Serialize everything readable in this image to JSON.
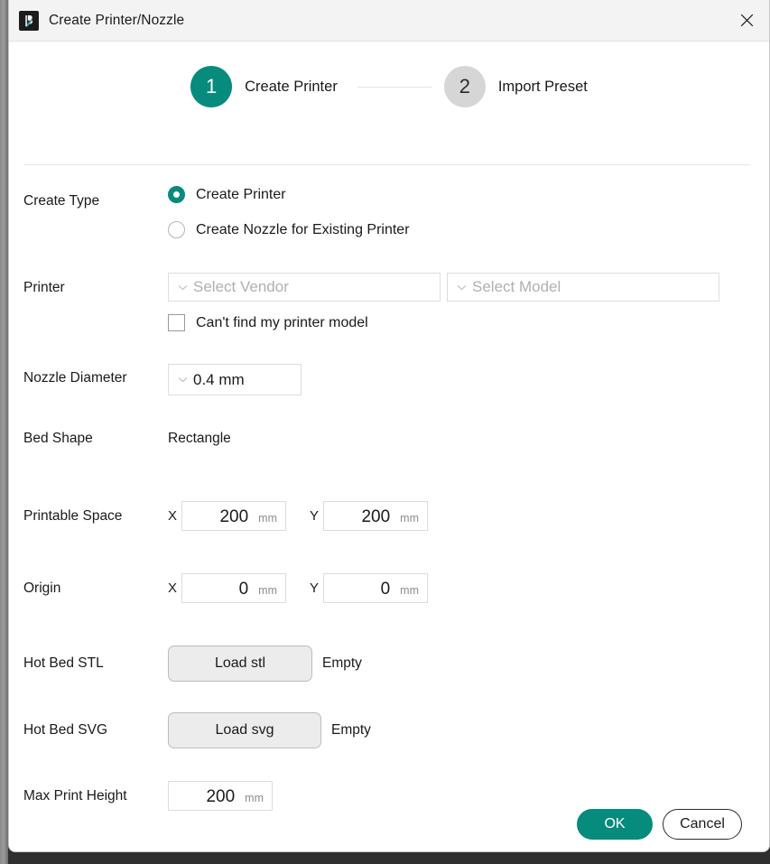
{
  "window": {
    "title": "Create Printer/Nozzle",
    "app_icon": "bambu-logo-icon",
    "close_label": "✕"
  },
  "theme": {
    "accent": "#068b7c",
    "inactive_step": "#d6d6d6",
    "placeholder_text": "#b0b0b0",
    "border": "#dddddd"
  },
  "stepper": {
    "steps": [
      {
        "number": "1",
        "label": "Create Printer",
        "state": "active"
      },
      {
        "number": "2",
        "label": "Import Preset",
        "state": "inactive"
      }
    ]
  },
  "form": {
    "create_type": {
      "label": "Create Type",
      "options": [
        {
          "label": "Create Printer",
          "selected": true
        },
        {
          "label": "Create Nozzle for Existing Printer",
          "selected": false
        }
      ]
    },
    "printer": {
      "label": "Printer",
      "vendor_placeholder": "Select Vendor",
      "model_placeholder": "Select Model",
      "cant_find_label": "Can't find my printer model",
      "cant_find_checked": false
    },
    "nozzle_diameter": {
      "label": "Nozzle Diameter",
      "value": "0.4 mm"
    },
    "bed_shape": {
      "label": "Bed Shape",
      "value": "Rectangle"
    },
    "printable_space": {
      "label": "Printable Space",
      "x_axis": "X",
      "x_value": "200",
      "x_unit": "mm",
      "y_axis": "Y",
      "y_value": "200",
      "y_unit": "mm"
    },
    "origin": {
      "label": "Origin",
      "x_axis": "X",
      "x_value": "0",
      "x_unit": "mm",
      "y_axis": "Y",
      "y_value": "0",
      "y_unit": "mm"
    },
    "hot_bed_stl": {
      "label": "Hot Bed STL",
      "button": "Load stl",
      "status": "Empty"
    },
    "hot_bed_svg": {
      "label": "Hot Bed SVG",
      "button": "Load svg",
      "status": "Empty"
    },
    "max_print_height": {
      "label": "Max Print Height",
      "value": "200",
      "unit": "mm"
    }
  },
  "footer": {
    "ok_label": "OK",
    "cancel_label": "Cancel"
  }
}
